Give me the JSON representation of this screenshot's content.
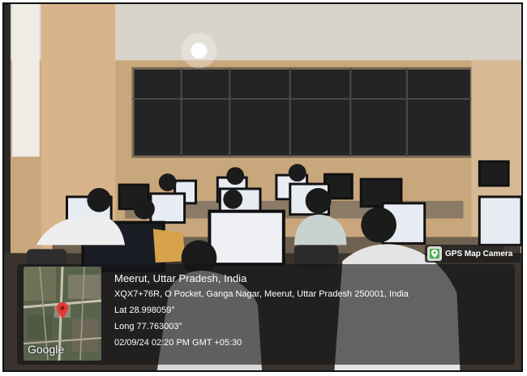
{
  "photo": {
    "subject": "computer-lab",
    "colors": {
      "wall": "#c9a77c",
      "ceiling": "#d8d4cb",
      "floor": "#3b342e",
      "glass": "#242424",
      "monitor_screen": "#e7ebf2",
      "student_shirt_yellow": "#d6a34a"
    }
  },
  "badge": {
    "label": "GPS Map Camera",
    "icon": "gps-map-camera-icon"
  },
  "stamp": {
    "location_title": "Meerut, Uttar Pradesh, India",
    "address": "XQX7+76R, O Pocket, Ganga Nagar, Meerut, Uttar Pradesh 250001, India",
    "latitude": "Lat 28.998059°",
    "longitude": "Long 77.763003°",
    "datetime": "02/09/24 02:20 PM GMT +05:30",
    "map": {
      "logo": "Google",
      "pin_icon": "map-pin-icon",
      "pin_color": "#e53935"
    }
  }
}
